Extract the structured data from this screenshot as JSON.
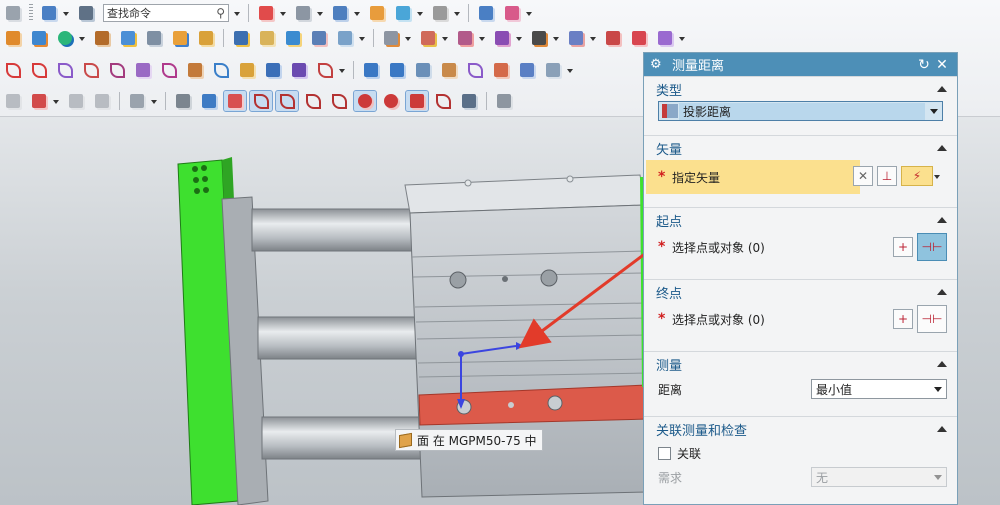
{
  "toolbar": {
    "command_search_value": "查找命令"
  },
  "viewport": {
    "tooltip_text": "面 在 MGPM50-75 中"
  },
  "dialog": {
    "title": "测量距离",
    "type_section": {
      "header": "类型",
      "selected": "投影距离"
    },
    "vector_section": {
      "header": "矢量",
      "field_label": "指定矢量"
    },
    "start_section": {
      "header": "起点",
      "field_label": "选择点或对象 (0)"
    },
    "end_section": {
      "header": "终点",
      "field_label": "选择点或对象 (0)"
    },
    "measure_section": {
      "header": "测量",
      "distance_label": "距离",
      "distance_value": "最小值"
    },
    "assoc_section": {
      "header": "关联测量和检查",
      "assoc_label": "关联",
      "requirement_label": "需求",
      "requirement_value": "无"
    }
  },
  "colors": {
    "title_bar": "#4d8fb7",
    "section_header_text": "#1c5a8a",
    "required_highlight": "#fbe08e",
    "green_face": "#3ee02f",
    "red_face": "#dc5a4a",
    "arrow": "#e23b2a",
    "vector_blue": "#3b45e0"
  }
}
